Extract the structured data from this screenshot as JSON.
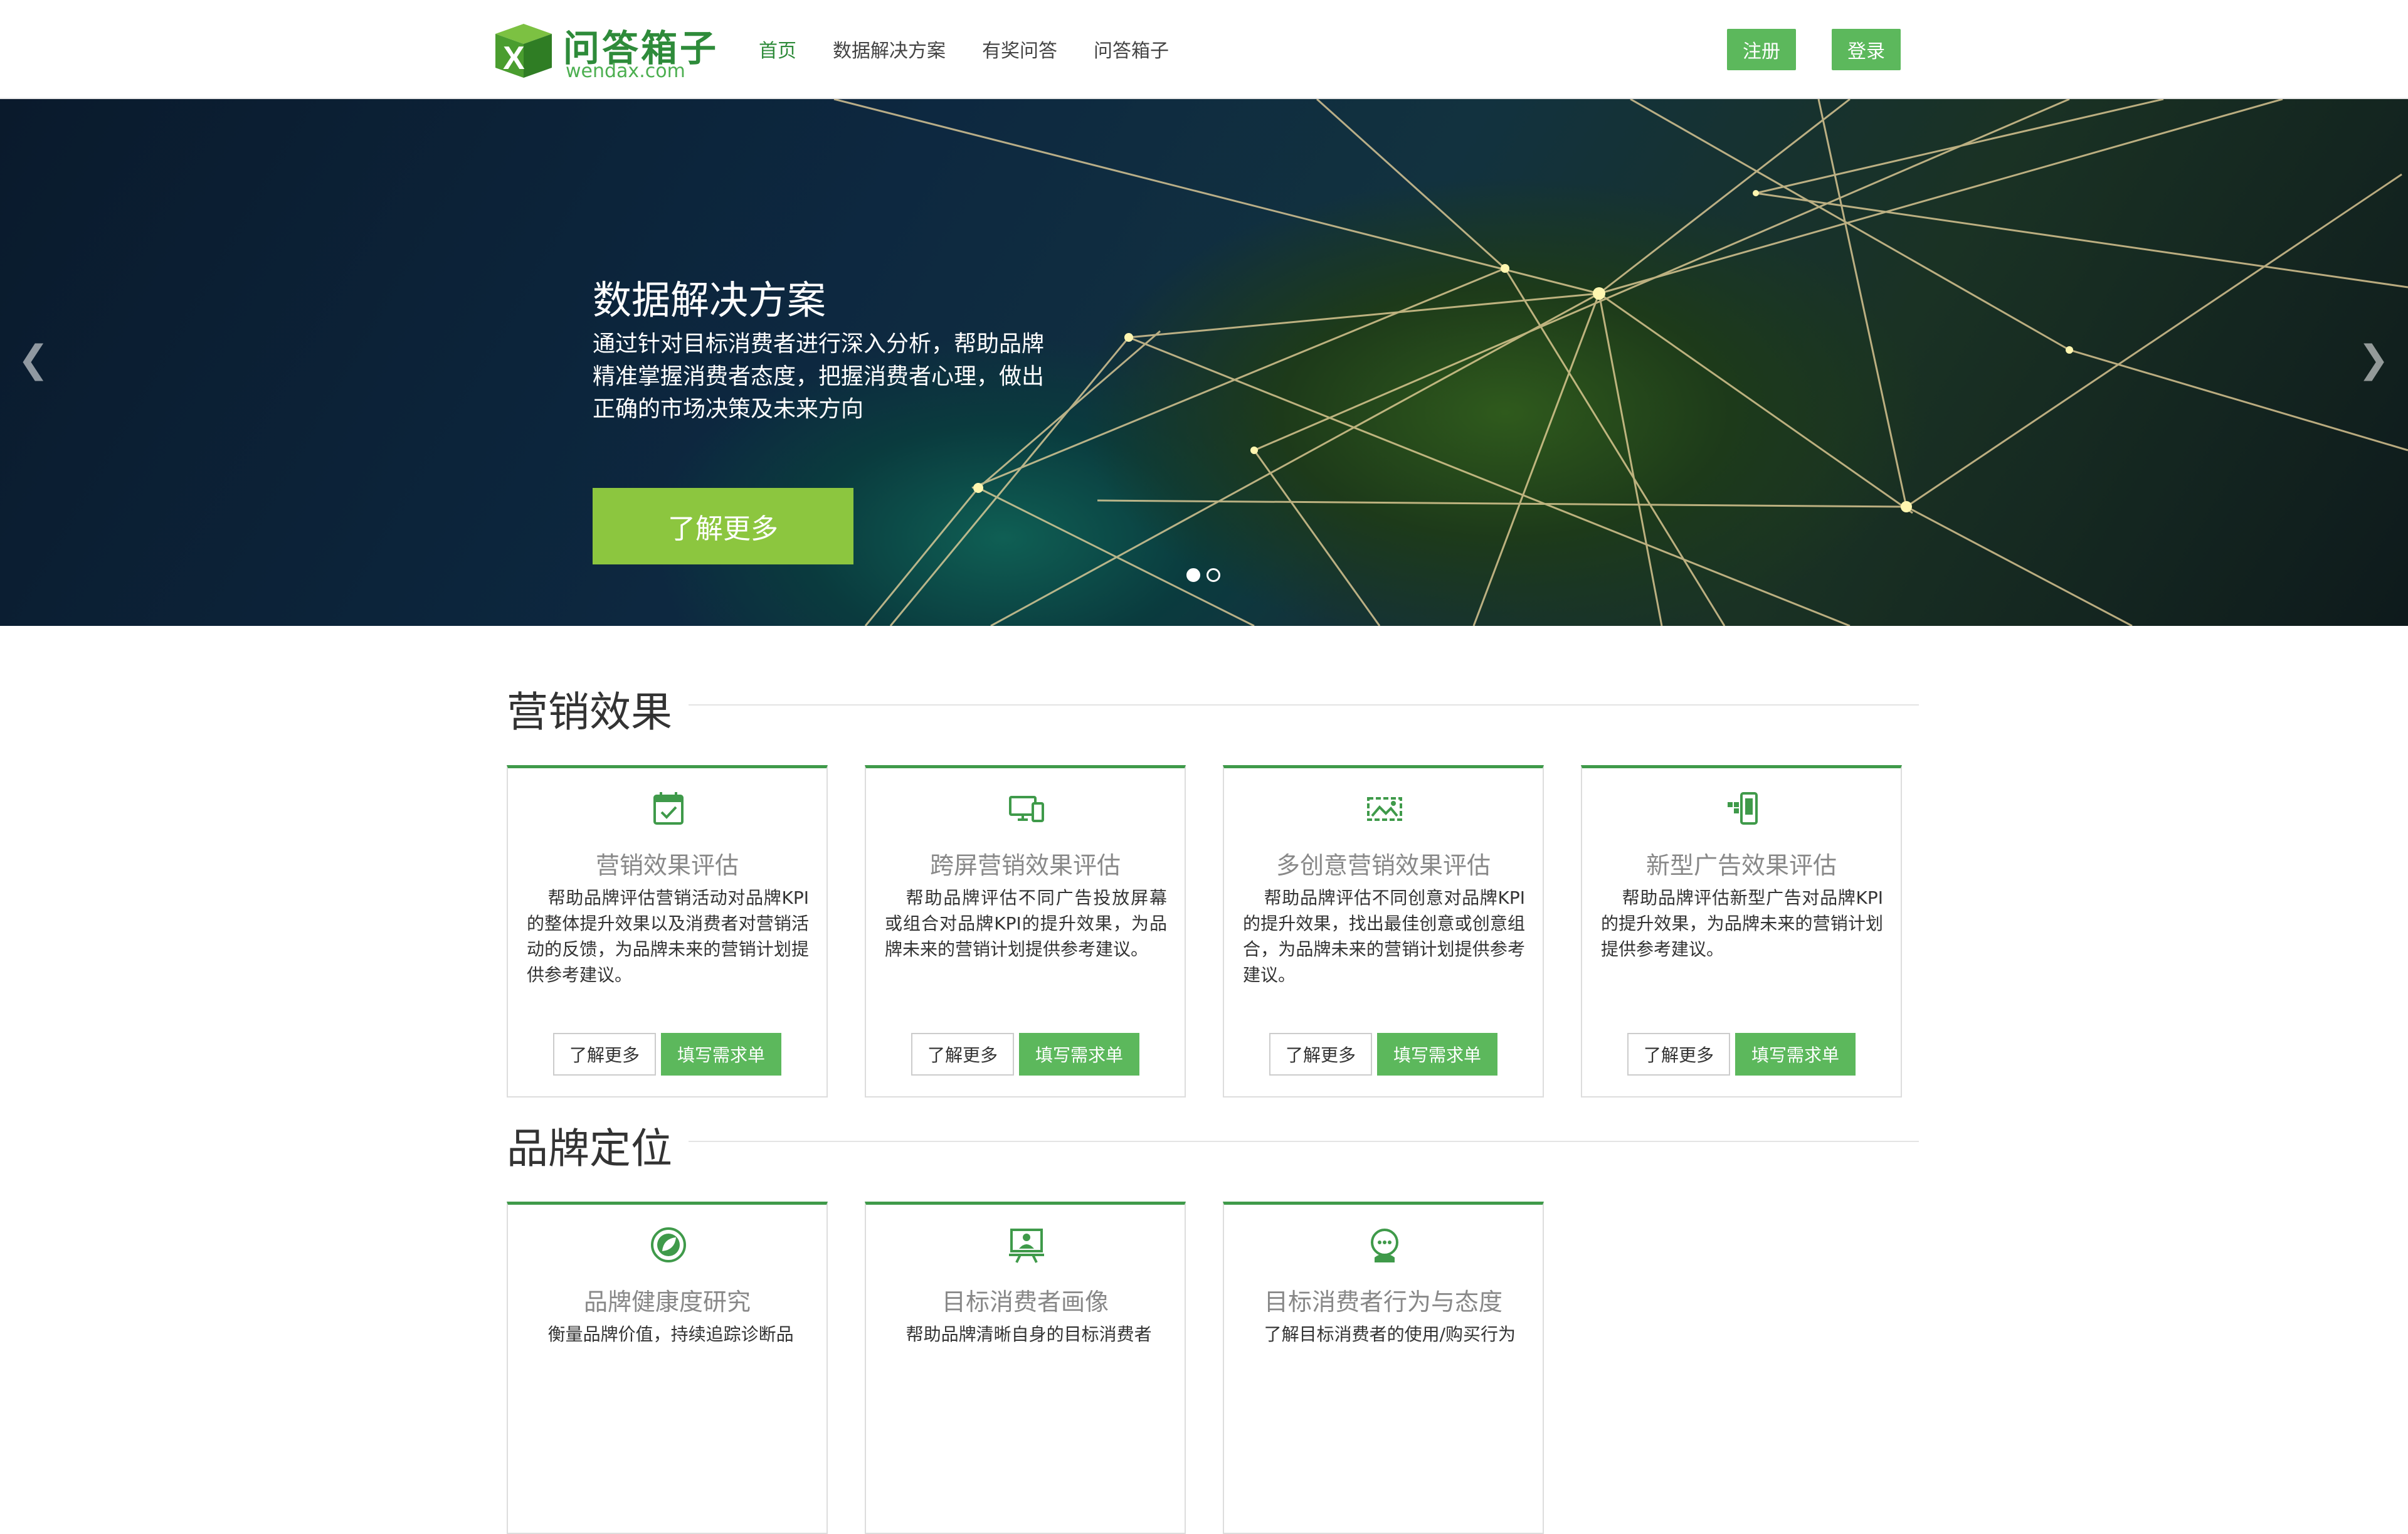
{
  "header": {
    "logo_title": "问答箱子",
    "logo_domain": "wendax.com",
    "nav": [
      {
        "label": "首页",
        "active": true
      },
      {
        "label": "数据解决方案",
        "active": false
      },
      {
        "label": "有奖问答",
        "active": false
      },
      {
        "label": "问答箱子",
        "active": false
      }
    ],
    "register_label": "注册",
    "login_label": "登录"
  },
  "hero": {
    "title": "数据解决方案",
    "text": "通过针对目标消费者进行深入分析，帮助品牌精准掌握消费者态度，把握消费者心理，做出正确的市场决策及未来方向",
    "button_label": "了解更多",
    "prev_icon": "chevron-left-icon",
    "next_icon": "chevron-right-icon",
    "slides_total": 2,
    "slide_active": 1
  },
  "sections": [
    {
      "title": "营销效果",
      "cards": [
        {
          "icon": "calendar-check-icon",
          "title": "营销效果评估",
          "desc": "帮助品牌评估营销活动对品牌KPI的整体提升效果以及消费者对营销活动的反馈，为品牌未来的营销计划提供参考建议。",
          "more_label": "了解更多",
          "form_label": "填写需求单"
        },
        {
          "icon": "devices-icon",
          "title": "跨屏营销效果评估",
          "desc": "帮助品牌评估不同广告投放屏幕或组合对品牌KPI的提升效果，为品牌未来的营销计划提供参考建议。",
          "more_label": "了解更多",
          "form_label": "填写需求单"
        },
        {
          "icon": "creative-ads-icon",
          "title": "多创意营销效果评估",
          "desc": "帮助品牌评估不同创意对品牌KPI的提升效果，找出最佳创意或创意组合，为品牌未来的营销计划提供参考建议。",
          "more_label": "了解更多",
          "form_label": "填写需求单"
        },
        {
          "icon": "mobile-ad-icon",
          "title": "新型广告效果评估",
          "desc": "帮助品牌评估新型广告对品牌KPI的提升效果，为品牌未来的营销计划提供参考建议。",
          "more_label": "了解更多",
          "form_label": "填写需求单"
        }
      ]
    },
    {
      "title": "品牌定位",
      "cards": [
        {
          "icon": "leaf-icon",
          "title": "品牌健康度研究",
          "desc": "衡量品牌价值，持续追踪诊断品",
          "more_label": "",
          "form_label": ""
        },
        {
          "icon": "presentation-icon",
          "title": "目标消费者画像",
          "desc": "帮助品牌清晰自身的目标消费者",
          "more_label": "",
          "form_label": ""
        },
        {
          "icon": "consumer-chat-icon",
          "title": "目标消费者行为与态度",
          "desc": "了解目标消费者的使用/购买行为",
          "more_label": "",
          "form_label": ""
        }
      ]
    }
  ],
  "colors": {
    "brand_green": "#5cb85c",
    "hero_button": "#8cc63f",
    "card_top": "#3f9a4a"
  }
}
